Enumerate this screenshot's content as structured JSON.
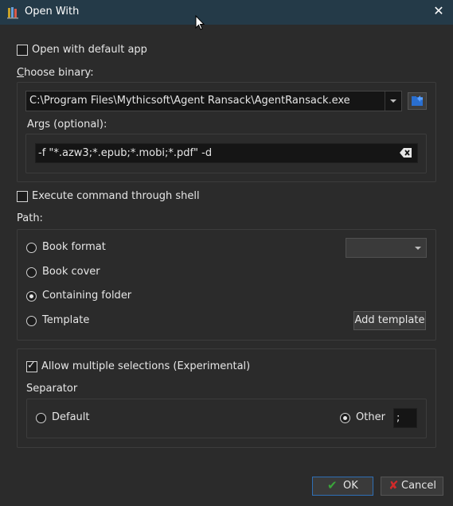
{
  "window": {
    "title": "Open With"
  },
  "open_default": {
    "label": "Open with default app",
    "checked": false
  },
  "choose_binary": {
    "label_prefix": "C",
    "label_rest": "hoose binary:",
    "path": "C:\\Program Files\\Mythicsoft\\Agent Ransack\\AgentRansack.exe",
    "args_label": "Args (optional):",
    "args_value": "-f \"*.azw3;*.epub;*.mobi;*.pdf\" -d"
  },
  "execute_shell": {
    "label": "Execute command through shell",
    "checked": false
  },
  "path_section": {
    "label": "Path:",
    "options": [
      {
        "label": "Book format",
        "checked": false
      },
      {
        "label": "Book cover",
        "checked": false
      },
      {
        "label": "Containing folder",
        "checked": true
      },
      {
        "label": "Template",
        "checked": false
      }
    ],
    "format_select": "",
    "add_template_label": "Add template"
  },
  "multi": {
    "label": "Allow multiple selections (Experimental)",
    "checked": true,
    "separator_label": "Separator",
    "default_label": "Default",
    "other_label": "Other",
    "other_value": ";",
    "default_checked": false,
    "other_checked": true
  },
  "buttons": {
    "ok": "OK",
    "cancel": "Cancel"
  },
  "colors": {
    "titlebar": "#243a48",
    "background": "#2b2b2b",
    "ok_border": "#2f6fb5",
    "ok_check": "#3aa63a",
    "cancel_x": "#d02a2a"
  }
}
